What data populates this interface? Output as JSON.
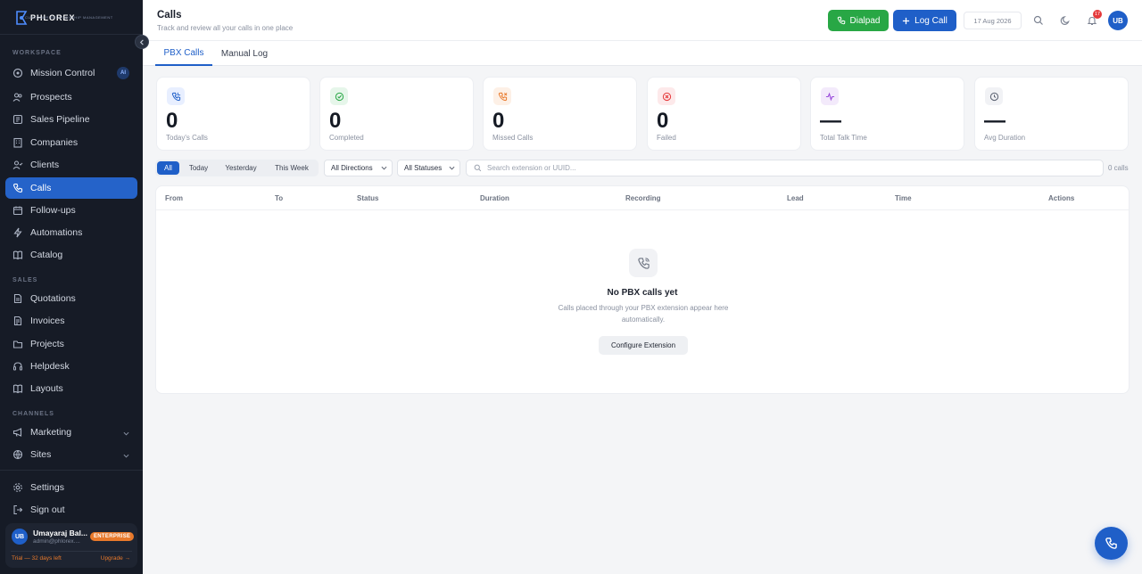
{
  "app": {
    "logo_text": "PHLOREX",
    "logo_tagline": "CUSTOMER RELATIONSHIP MANAGEMENT"
  },
  "sidebar": {
    "sections": {
      "workspace": "WORKSPACE",
      "sales": "SALES",
      "channels": "CHANNELS"
    },
    "mission_control": {
      "label": "Mission Control",
      "badge": "AI"
    },
    "items": [
      {
        "label": "Prospects",
        "icon": "users-icon"
      },
      {
        "label": "Sales Pipeline",
        "icon": "pipeline-icon"
      },
      {
        "label": "Companies",
        "icon": "building-icon"
      },
      {
        "label": "Clients",
        "icon": "user-check-icon"
      },
      {
        "label": "Calls",
        "icon": "phone-icon",
        "active": true
      },
      {
        "label": "Follow-ups",
        "icon": "calendar-icon"
      },
      {
        "label": "Automations",
        "icon": "bolt-icon"
      },
      {
        "label": "Catalog",
        "icon": "book-icon"
      }
    ],
    "sales_items": [
      {
        "label": "Quotations",
        "icon": "document-icon"
      },
      {
        "label": "Invoices",
        "icon": "invoice-icon"
      },
      {
        "label": "Projects",
        "icon": "folder-icon"
      },
      {
        "label": "Helpdesk",
        "icon": "headset-icon"
      },
      {
        "label": "Layouts",
        "icon": "layout-icon"
      }
    ],
    "channel_items": [
      {
        "label": "Marketing",
        "icon": "megaphone-icon"
      },
      {
        "label": "Sites",
        "icon": "globe-icon"
      }
    ],
    "settings": "Settings",
    "sign_out": "Sign out",
    "user": {
      "initials": "UB",
      "name": "Umayaraj Bal...",
      "email": "admin@phlorex....",
      "plan": "ENTERPRISE",
      "trial": "Trial — 32 days left",
      "upgrade": "Upgrade →"
    }
  },
  "header": {
    "title": "Calls",
    "subtitle": "Track and review all your calls in one place",
    "dialpad": "Dialpad",
    "log_call": "Log Call",
    "date": "17 Aug 2026",
    "notifications": "17",
    "avatar": "UB"
  },
  "tabs": [
    "PBX Calls",
    "Manual Log"
  ],
  "stats": [
    {
      "value": "0",
      "label": "Today's Calls",
      "color": "#1f5fc8",
      "bg": "#e8efff"
    },
    {
      "value": "0",
      "label": "Completed",
      "color": "#28a745",
      "bg": "#e6f6ea"
    },
    {
      "value": "0",
      "label": "Missed Calls",
      "color": "#e8792b",
      "bg": "#fdf0e6"
    },
    {
      "value": "0",
      "label": "Failed",
      "color": "#e5393b",
      "bg": "#fde9ea"
    },
    {
      "value": "—",
      "label": "Total Talk Time",
      "color": "#9b4ddb",
      "bg": "#f3eafb"
    },
    {
      "value": "—",
      "label": "Avg Duration",
      "color": "#5a6170",
      "bg": "#f1f2f5"
    }
  ],
  "filters": {
    "segments": [
      "All",
      "Today",
      "Yesterday",
      "This Week"
    ],
    "direction": "All Directions",
    "status": "All Statuses",
    "search_placeholder": "Search extension or UUID...",
    "count": "0 calls"
  },
  "table": {
    "columns": [
      "From",
      "To",
      "Status",
      "Duration",
      "Recording",
      "Lead",
      "Time",
      "Actions"
    ],
    "empty_title": "No PBX calls yet",
    "empty_desc": "Calls placed through your PBX extension appear here automatically.",
    "empty_action": "Configure Extension"
  }
}
